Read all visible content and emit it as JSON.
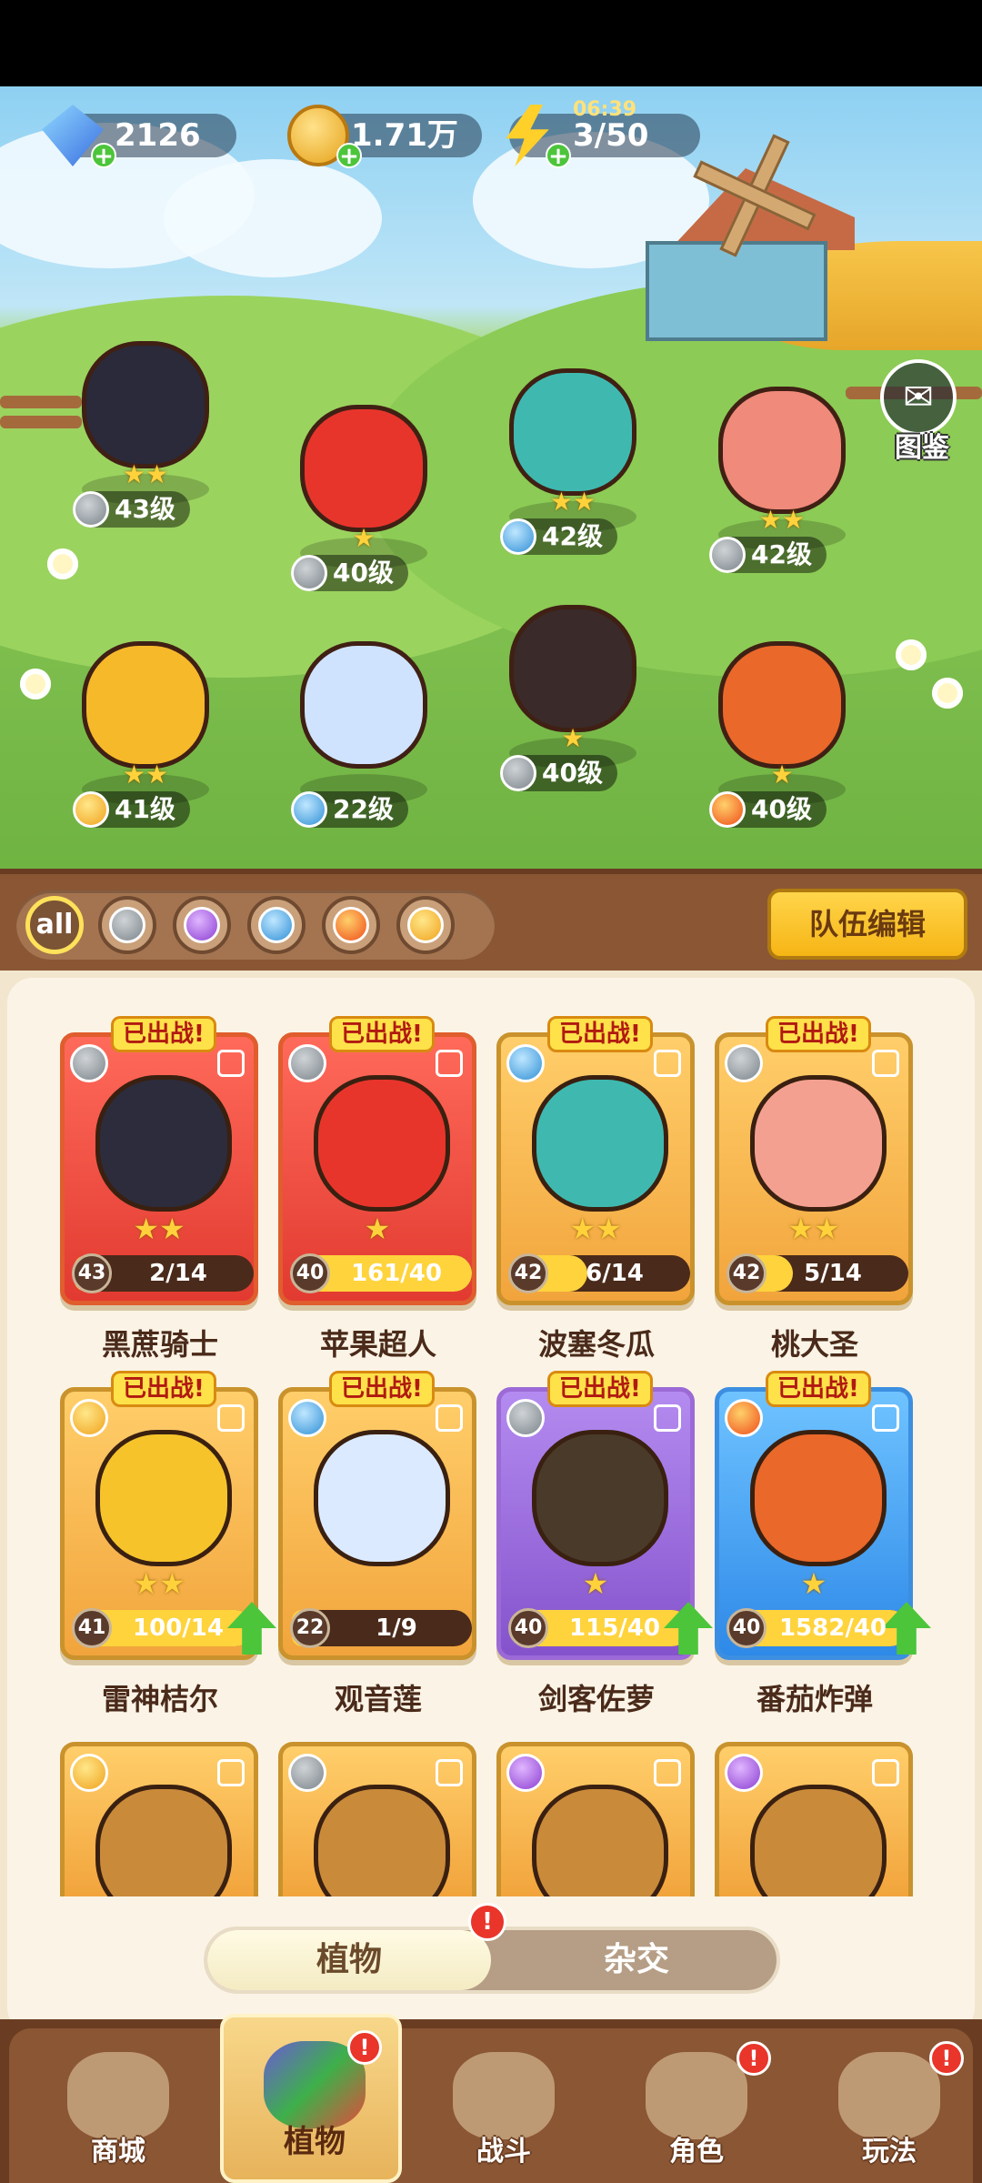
{
  "resources": {
    "gems": "2126",
    "gold": "1.71万",
    "energy": "3/50",
    "energy_timer": "06:39",
    "plus": "+"
  },
  "dex_label": "图鉴",
  "dex_icon": "book-icon",
  "field": [
    {
      "level": "43级",
      "element": "metal",
      "stars": "★★"
    },
    {
      "level": "40级",
      "element": "metal",
      "stars": "★"
    },
    {
      "level": "42级",
      "element": "water",
      "stars": "★★"
    },
    {
      "level": "42级",
      "element": "metal",
      "stars": "★★"
    },
    {
      "level": "41级",
      "element": "thunder",
      "stars": "★★"
    },
    {
      "level": "22级",
      "element": "water",
      "stars": ""
    },
    {
      "level": "40级",
      "element": "metal",
      "stars": "★"
    },
    {
      "level": "40级",
      "element": "fire",
      "stars": "★"
    }
  ],
  "filters": {
    "all_label": "all",
    "items": [
      "all",
      "metal",
      "poison",
      "water",
      "fire",
      "thunder"
    ]
  },
  "team_edit_label": "队伍编辑",
  "deployed_label": "已出战!",
  "cards": [
    {
      "name": "黑蔗骑士",
      "level": "43",
      "progress": "2/14",
      "fill": 0.14,
      "stars": "★★",
      "theme": "red",
      "element": "metal",
      "upgrade": false
    },
    {
      "name": "苹果超人",
      "level": "40",
      "progress": "161/40",
      "fill": 1.0,
      "stars": "★",
      "theme": "red",
      "element": "metal",
      "upgrade": false
    },
    {
      "name": "波塞冬瓜",
      "level": "42",
      "progress": "6/14",
      "fill": 0.43,
      "stars": "★★",
      "theme": "gold",
      "element": "water",
      "upgrade": false
    },
    {
      "name": "桃大圣",
      "level": "42",
      "progress": "5/14",
      "fill": 0.36,
      "stars": "★★",
      "theme": "gold",
      "element": "metal",
      "upgrade": false
    },
    {
      "name": "雷神桔尔",
      "level": "41",
      "progress": "100/14",
      "fill": 1.0,
      "stars": "★★",
      "theme": "gold",
      "element": "thunder",
      "upgrade": true
    },
    {
      "name": "观音莲",
      "level": "22",
      "progress": "1/9",
      "fill": 0.11,
      "stars": "",
      "theme": "gold",
      "element": "water",
      "upgrade": false
    },
    {
      "name": "剑客佐萝",
      "level": "40",
      "progress": "115/40",
      "fill": 1.0,
      "stars": "★",
      "theme": "purple",
      "element": "metal",
      "upgrade": true
    },
    {
      "name": "番茄炸弹",
      "level": "40",
      "progress": "1582/40",
      "fill": 1.0,
      "stars": "★",
      "theme": "blue",
      "element": "fire",
      "upgrade": true
    }
  ],
  "partial_cards": [
    {
      "element": "thunder"
    },
    {
      "element": "metal"
    },
    {
      "element": "poison"
    },
    {
      "element": "poison"
    }
  ],
  "segment": {
    "plants": "植物",
    "hybrid": "杂交",
    "alert": "!"
  },
  "nav": [
    {
      "label": "商城",
      "active": false,
      "alert": false
    },
    {
      "label": "植物",
      "active": true,
      "alert": true
    },
    {
      "label": "战斗",
      "active": false,
      "alert": false
    },
    {
      "label": "角色",
      "active": false,
      "alert": true
    },
    {
      "label": "玩法",
      "active": false,
      "alert": true
    }
  ],
  "colors": {
    "accent_gold": "#ffd54a",
    "wood": "#8a5634",
    "alert_red": "#e9352a",
    "upgrade_green": "#4cc53b"
  }
}
